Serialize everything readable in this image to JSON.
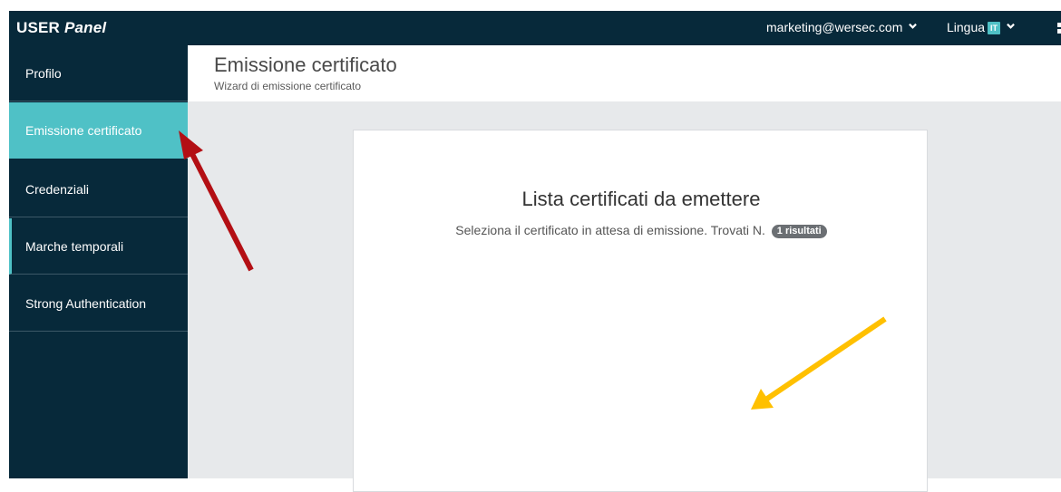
{
  "app": {
    "brand_user": "USER",
    "brand_panel": "Panel"
  },
  "topbar": {
    "user_email": "marketing@wersec.com",
    "language_label": "Lingua",
    "language_code": "IT",
    "icons": [
      "chevron-down-icon",
      "apps-grid-icon"
    ]
  },
  "sidebar": {
    "items": [
      {
        "label": "Profilo"
      },
      {
        "label": "Emissione certificato"
      },
      {
        "label": "Credenziali"
      },
      {
        "label": "Marche temporali"
      },
      {
        "label": "Strong Authentication"
      }
    ],
    "active_index": 1
  },
  "page": {
    "title": "Emissione certificato",
    "subtitle": "Wizard di emissione certificato"
  },
  "card": {
    "title": "Lista certificati da emettere",
    "description": "Seleziona il certificato in attesa di emissione. Trovati N.",
    "count_badge": "1 risultati"
  },
  "annotations": {
    "arrow_colors": {
      "red": "#b30f14",
      "yellow": "#ffc000"
    }
  },
  "colors": {
    "nav_dark": "#07293a",
    "accent_teal": "#4fc1c6",
    "content_bg": "#e7e9eb"
  }
}
